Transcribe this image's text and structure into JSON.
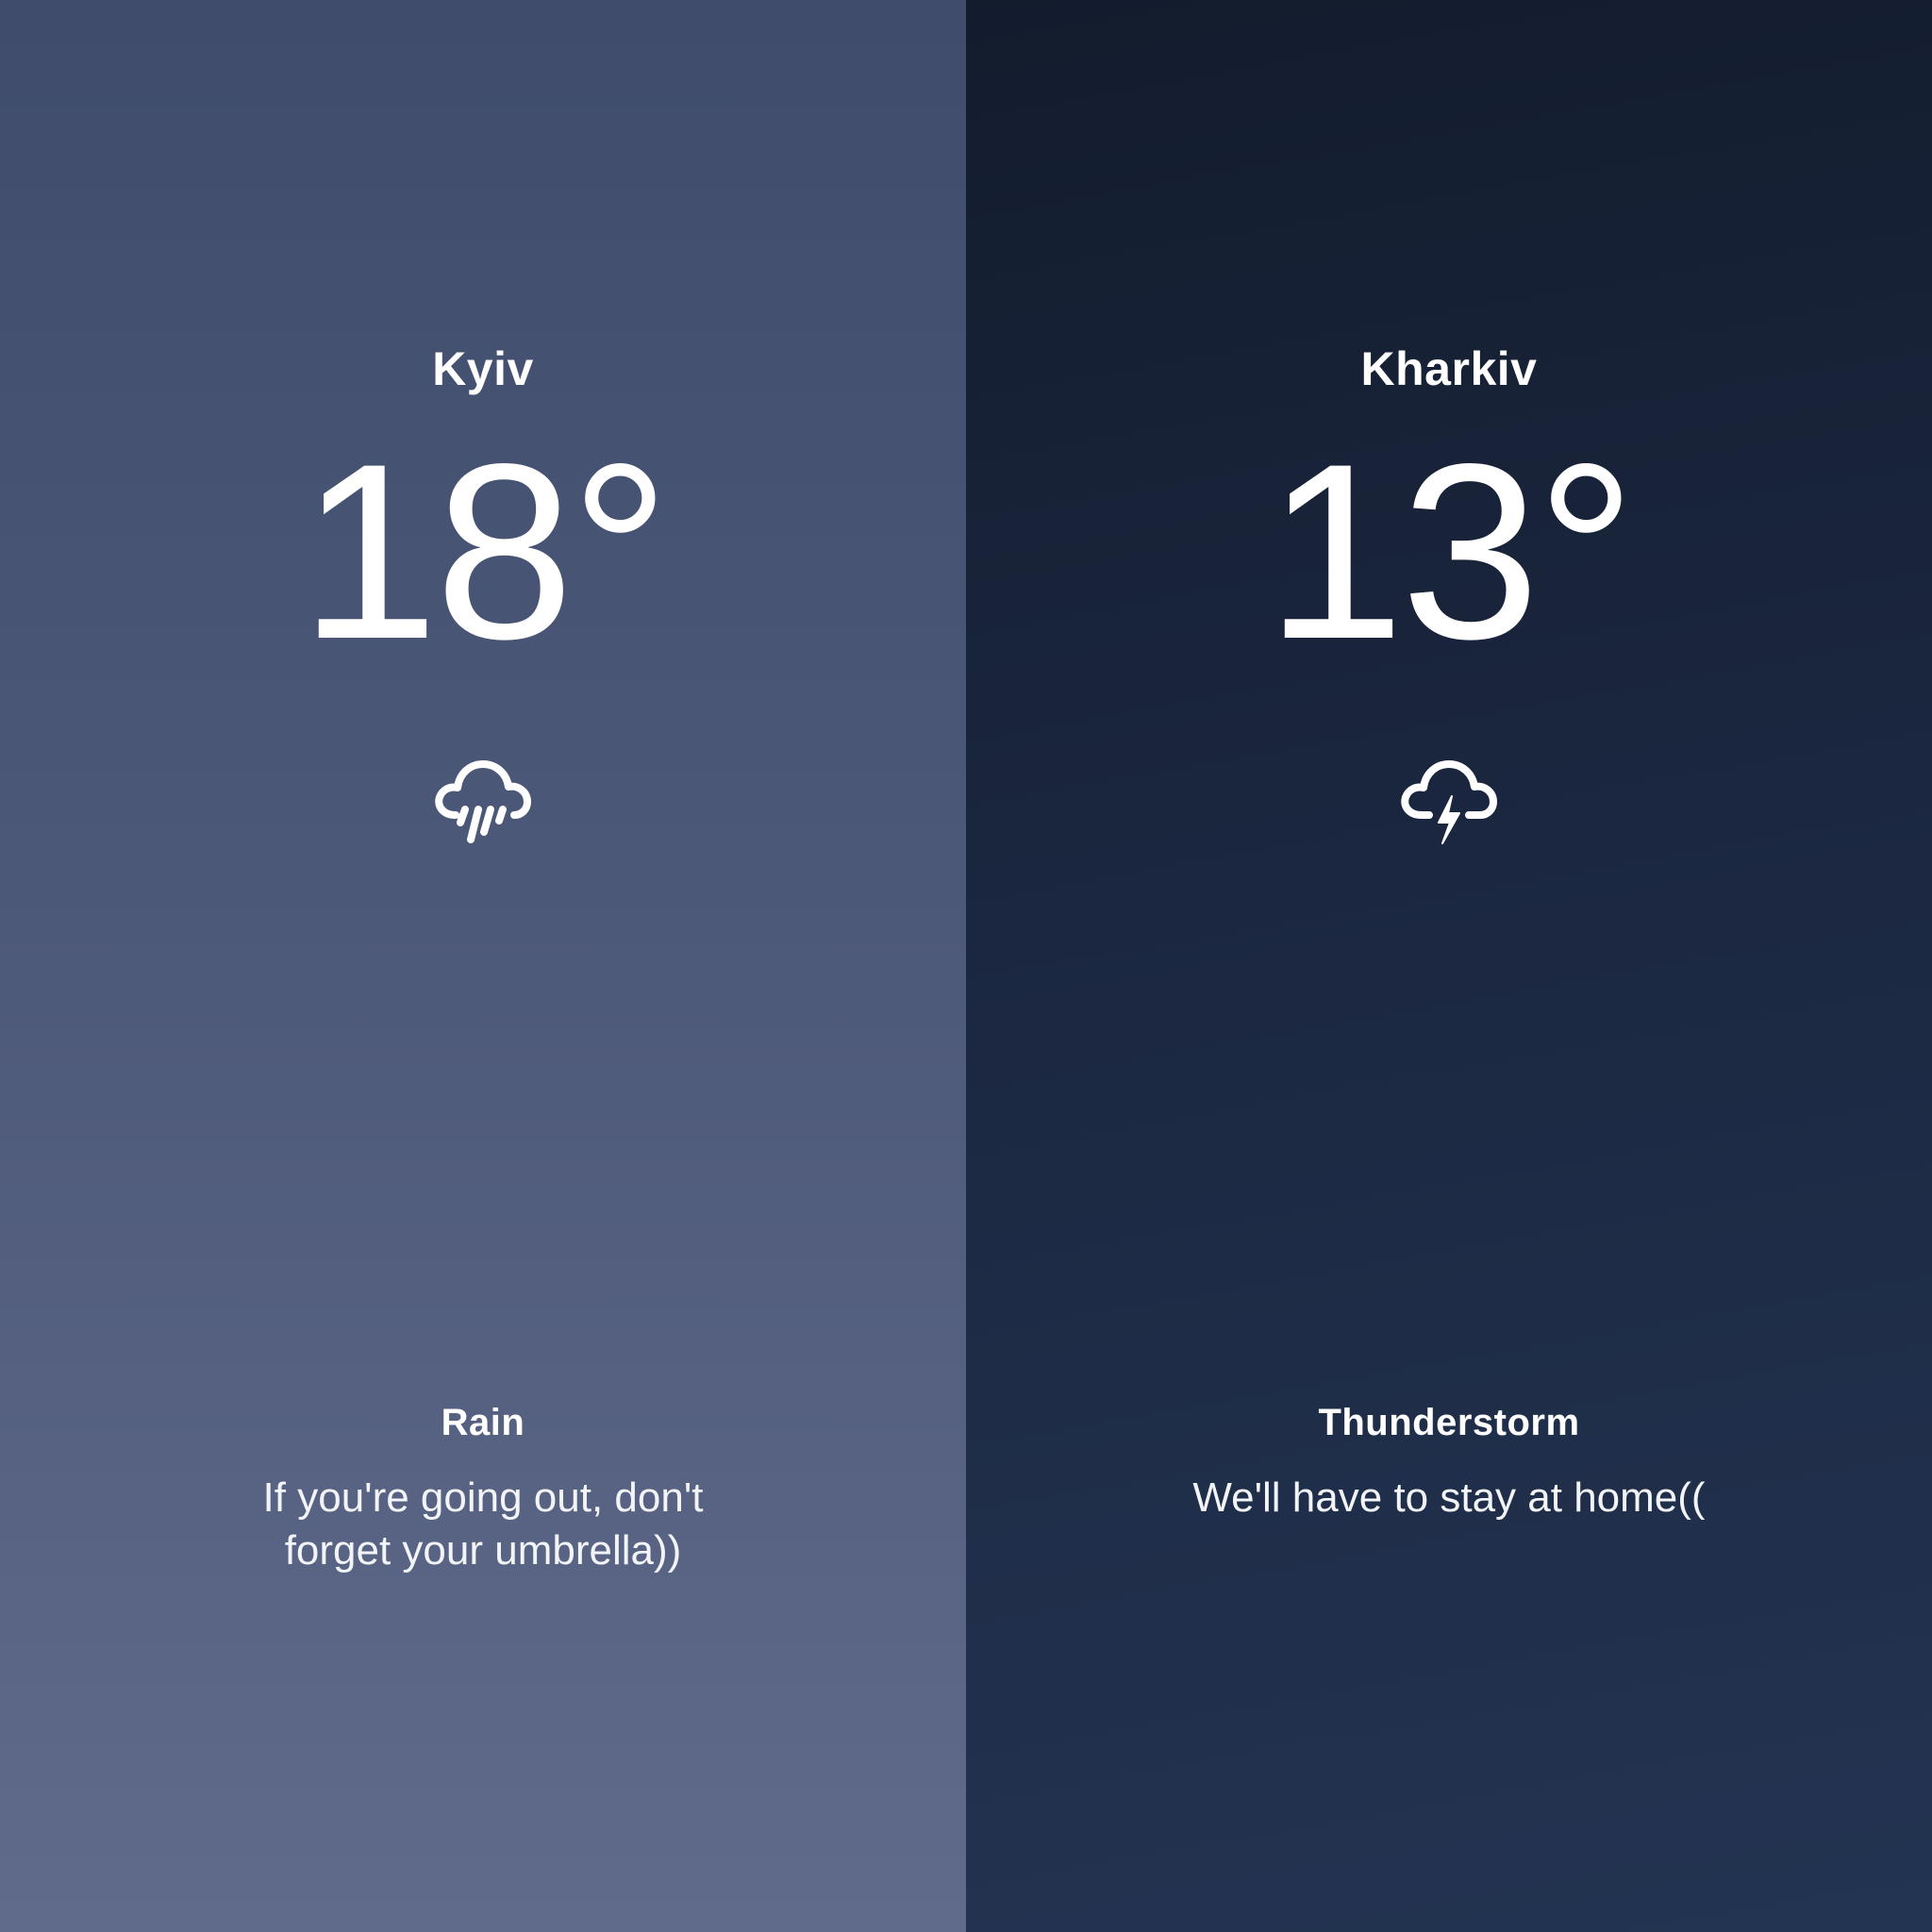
{
  "panels": [
    {
      "city": "Kyiv",
      "temperature": "18°",
      "icon": "cloud-rain-icon",
      "condition": "Rain",
      "message": "If you're going out, don't forget your umbrella))",
      "background": [
        "#3f4c6c",
        "#606a8a"
      ]
    },
    {
      "city": "Kharkiv",
      "temperature": "13°",
      "icon": "cloud-lightning-icon",
      "condition": "Thunderstorm",
      "message": "We'll have to stay at home((",
      "background": [
        "#131c2d",
        "#233452"
      ]
    }
  ]
}
